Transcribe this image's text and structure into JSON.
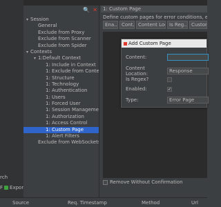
{
  "left_panel": {
    "search_label": "rch",
    "f_label": "F",
    "export_label": "Expor"
  },
  "tree": {
    "items": [
      {
        "label": "Session",
        "expanded": true,
        "level": 0
      },
      {
        "label": "General",
        "level": 1
      },
      {
        "label": "Exclude from Proxy",
        "level": 1
      },
      {
        "label": "Exclude from Scanner",
        "level": 1
      },
      {
        "label": "Exclude from Spider",
        "level": 1
      },
      {
        "label": "Contexts",
        "expanded": true,
        "level": 0
      },
      {
        "label": "1:Default Context",
        "expanded": true,
        "level": 1
      },
      {
        "label": "1: Include in Context",
        "level": 2
      },
      {
        "label": "1: Exclude from Conte",
        "level": 2
      },
      {
        "label": "1: Structure",
        "level": 2
      },
      {
        "label": "1: Technology",
        "level": 2
      },
      {
        "label": "1: Authentication",
        "level": 2
      },
      {
        "label": "1: Users",
        "level": 2
      },
      {
        "label": "1: Forced User",
        "level": 2
      },
      {
        "label": "1: Session Manageme",
        "level": 2
      },
      {
        "label": "1: Authorization",
        "level": 2
      },
      {
        "label": "1: Access Control",
        "level": 2
      },
      {
        "label": "1: Custom Page",
        "level": 2,
        "selected": true
      },
      {
        "label": "1: Alert Filters",
        "level": 2
      },
      {
        "label": "Exclude from WebSockets",
        "level": 1
      }
    ]
  },
  "content": {
    "header": "1: Custom Page",
    "description": "Define custom pages for error conditions, etc.",
    "columns": [
      "Ena...",
      "Cont...",
      "Content Loc...",
      "Is Reg...",
      "Custom"
    ],
    "remove_label": "Remove Without Confirmation"
  },
  "dialog": {
    "title": "Add Custom Page",
    "content_label": "Content:",
    "location_label": "Content Location:",
    "location_value": "Response",
    "regex_label": "Is Regex?",
    "enabled_label": "Enabled:",
    "type_label": "Type:",
    "type_value": "Error Page"
  },
  "bottom": {
    "source": "Source",
    "timestamp": "Req. Timestamp",
    "method": "Method",
    "url": "Url"
  }
}
